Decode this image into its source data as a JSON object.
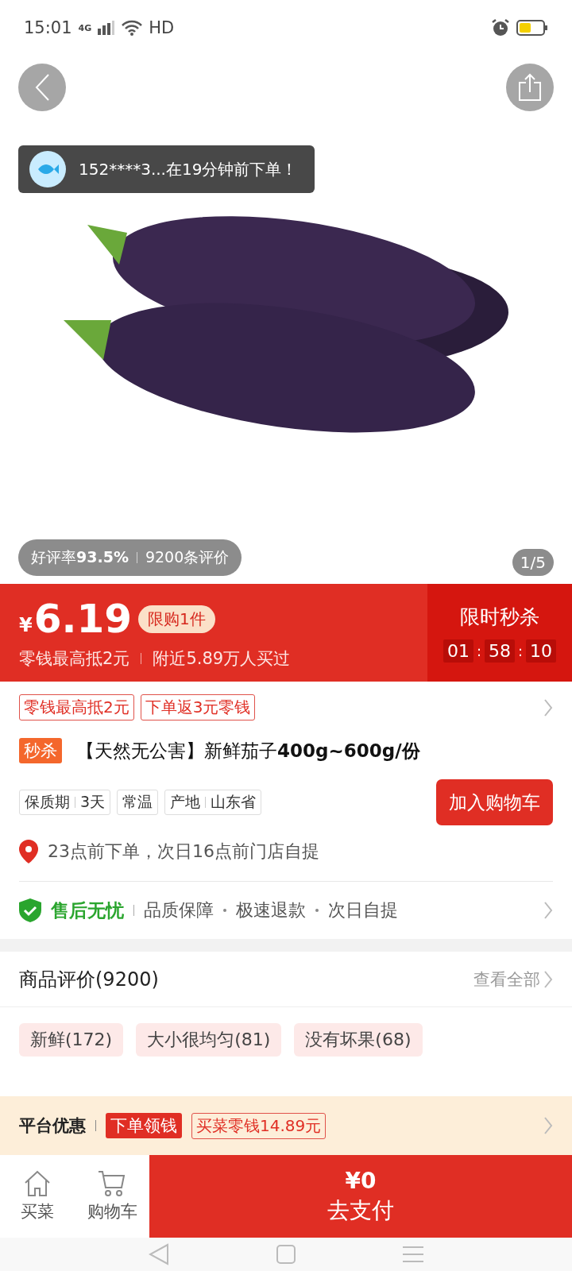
{
  "status_bar": {
    "time": "15:01",
    "network": "4G",
    "hd": "HD"
  },
  "toast": {
    "text": "152****3...在19分钟前下单！"
  },
  "rating": {
    "rate": "好评率**93.5%**",
    "reviews": "9200条评价"
  },
  "gallery": {
    "counter": "1/5"
  },
  "price": {
    "currency": "¥",
    "amount": "6.19",
    "limit": "限购1件",
    "notes": [
      "零钱最高抵2元",
      "附近5.89万人买过"
    ]
  },
  "flash_sale": {
    "title": "限时秒杀",
    "timer": [
      {
        "kind": "digits",
        "text": "01"
      },
      {
        "kind": "colon",
        "text": ":"
      },
      {
        "kind": "digits",
        "text": "58"
      },
      {
        "kind": "colon",
        "text": ":"
      },
      {
        "kind": "digits",
        "text": "10"
      }
    ]
  },
  "coupons": [
    "零钱最高抵2元",
    "下单返3元零钱"
  ],
  "product": {
    "badge": "秒杀",
    "title": "【天然无公害】新鲜茄子**400g~600g/份**"
  },
  "specs": [
    {
      "label": "保质期",
      "value": "3天"
    },
    {
      "label": "常温"
    },
    {
      "label": "产地",
      "value": "山东省"
    }
  ],
  "add_to_cart": "加入购物车",
  "delivery": "23点前下单，次日16点前门店自提",
  "guarantee": {
    "title": "售后无忧",
    "items": [
      "品质保障",
      "极速退款",
      "次日自提"
    ]
  },
  "reviews": {
    "title": "商品评价(9200)",
    "view_all": "查看全部",
    "tags": [
      "新鲜(172)",
      "大小很均匀(81)",
      "没有坏果(68)"
    ]
  },
  "promo": {
    "title": "平台优惠",
    "badge": "下单领钱",
    "coupon": "买菜零钱14.89元"
  },
  "bottom_nav": [
    {
      "kind": "home",
      "label": "买菜"
    },
    {
      "kind": "cart",
      "label": "购物车"
    }
  ],
  "pay": {
    "amount": "¥0",
    "label": "去支付"
  }
}
